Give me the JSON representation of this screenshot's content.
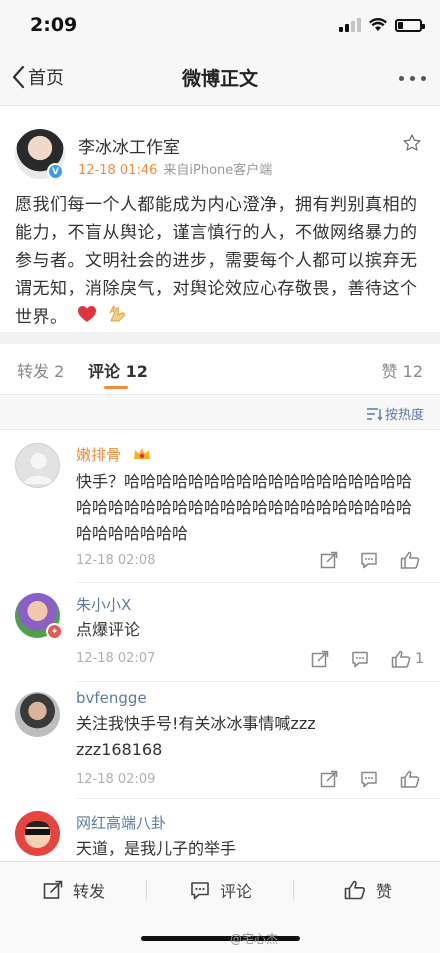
{
  "status_bar": {
    "time": "2:09"
  },
  "nav": {
    "back_label": "首页",
    "title": "微博正文"
  },
  "post": {
    "author": "李冰冰工作室",
    "time": "12-18 01:46",
    "source": "来自iPhone客户端",
    "body": "愿我们每一个人都能成为内心澄净，拥有判别真相的能力，不盲从舆论，谨言慎行的人，不做网络暴力的参与者。文明社会的进步，需要每个人都可以摈弃无谓无知，消除戾气，对舆论效应心存敬畏，善待这个世界。"
  },
  "tabs": {
    "repost": "转发 2",
    "comments": "评论 12",
    "likes": "赞 12"
  },
  "sort": {
    "label": "按热度"
  },
  "comments": [
    {
      "name": "嫩排骨",
      "text": "快手？哈哈哈哈哈哈哈哈哈哈哈哈哈哈哈哈哈哈哈哈哈哈哈哈哈哈哈哈哈哈哈哈哈哈哈哈哈哈哈哈哈哈哈哈哈哈",
      "time": "12-18 02:08",
      "likes": ""
    },
    {
      "name": "朱小小X",
      "text": "点爆评论",
      "time": "12-18 02:07",
      "likes": "1"
    },
    {
      "name": "bvfengge",
      "text": "关注我快手号!有关冰冰事情喊zzzzzz168168",
      "time": "12-18 02:09",
      "likes": ""
    },
    {
      "name": "网红高端八卦",
      "text": "天道，是我儿子的举手",
      "time": "",
      "likes": ""
    }
  ],
  "footer": {
    "repost": "转发",
    "comment": "评论",
    "like": "赞"
  },
  "watermark": "@宅心杰"
}
